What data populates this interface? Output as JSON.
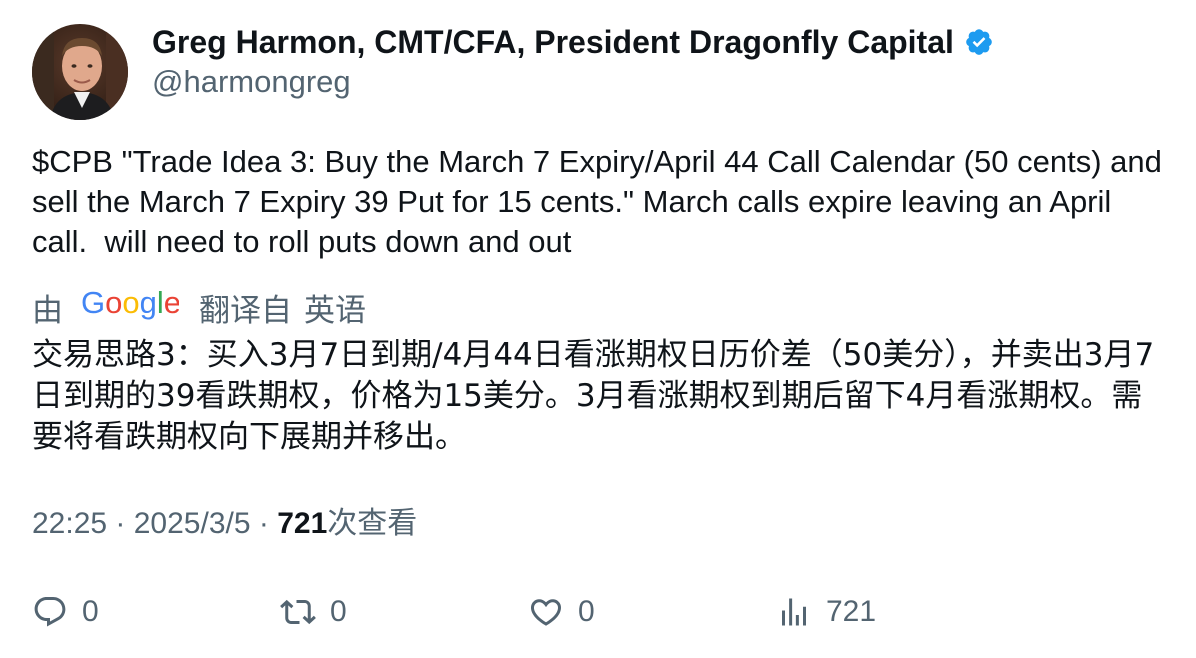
{
  "author": {
    "name": "Greg Harmon, CMT/CFA, President Dragonfly Capital",
    "handle": "@harmongreg",
    "verified_color": "#1d9bf0"
  },
  "tweet": {
    "text": "$CPB \"Trade Idea 3: Buy the March 7 Expiry/April 44 Call Calendar (50 cents) and sell the March 7 Expiry 39 Put for 15 cents.\" March calls expire leaving an April call.  will need to roll puts down and out"
  },
  "translation": {
    "by_label": "由",
    "provider": "Google",
    "translated_from": "翻译自",
    "language": "英语",
    "text": "交易思路3：买入3月7日到期/4月44日看涨期权日历价差（50美分），并卖出3月7日到期的39看跌期权，价格为15美分。3月看涨期权到期后留下4月看涨期权。需要将看跌期权向下展期并移出。"
  },
  "meta": {
    "time": "22:25",
    "separator": "·",
    "date": "2025/3/5",
    "views_count": "721",
    "views_label": "次查看"
  },
  "actions": {
    "reply_count": "0",
    "retweet_count": "0",
    "like_count": "0",
    "views_count": "721"
  },
  "colors": {
    "text_primary": "#0f1419",
    "text_secondary": "#536471",
    "google_blue": "#4285F4",
    "google_red": "#EA4335",
    "google_yellow": "#FBBC05",
    "google_green": "#34A853"
  }
}
